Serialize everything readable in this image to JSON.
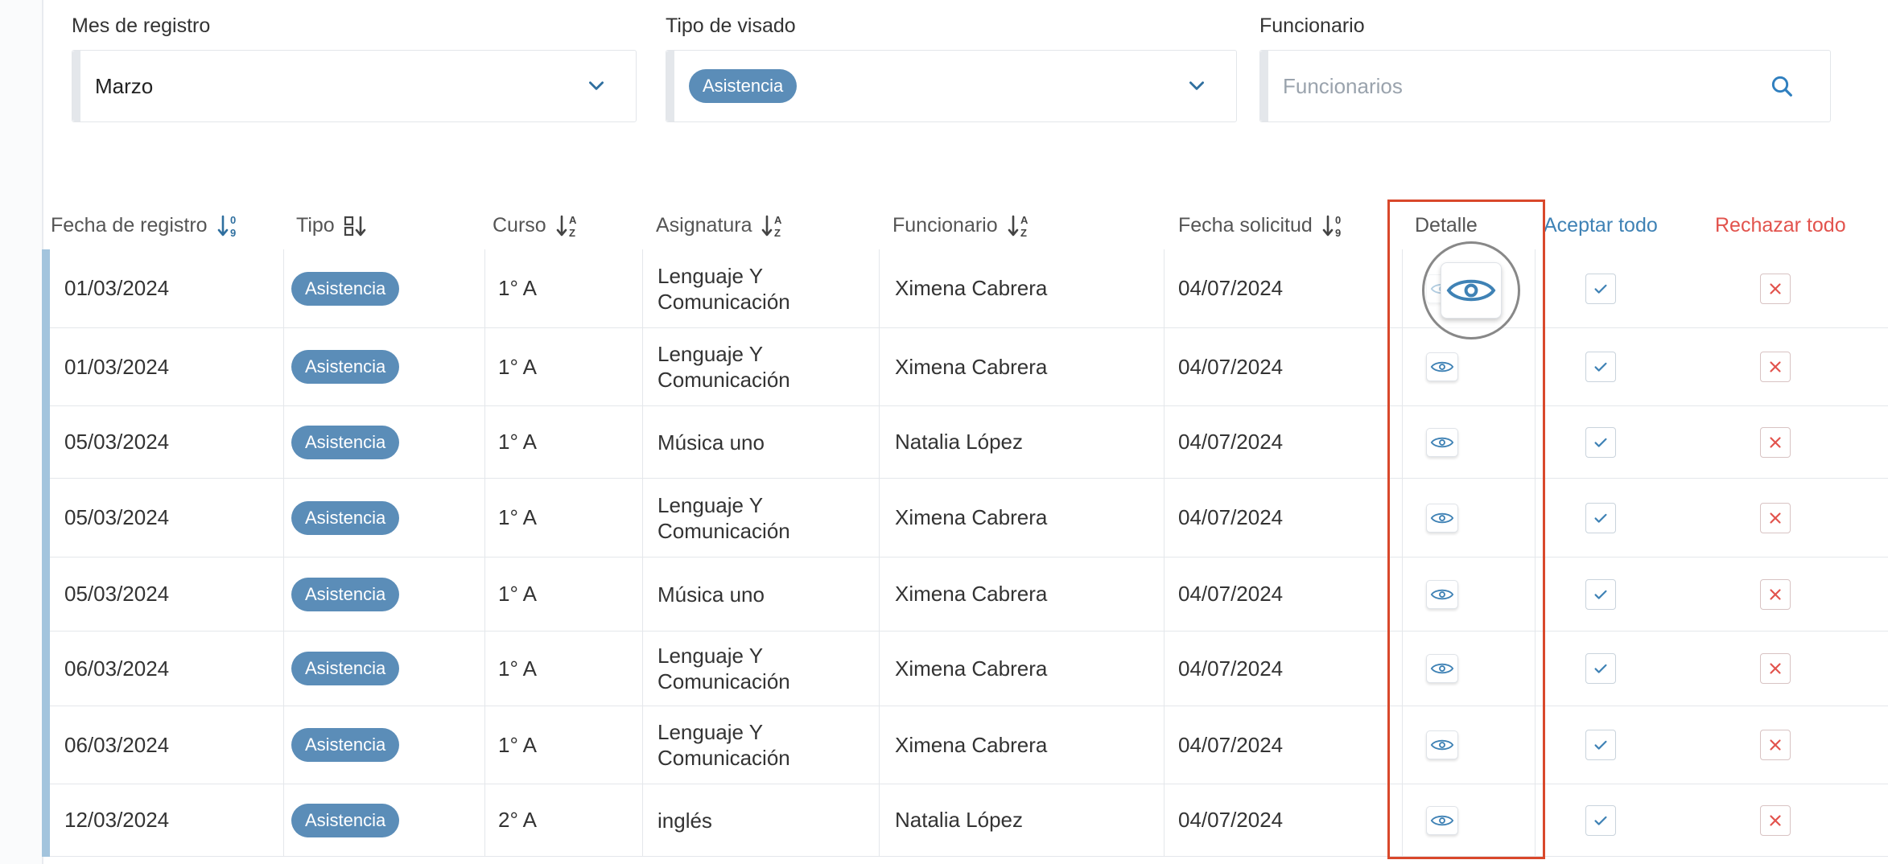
{
  "filters": {
    "month": {
      "label": "Mes de registro",
      "value": "Marzo"
    },
    "visa_type": {
      "label": "Tipo de visado",
      "selected_tag": "Asistencia"
    },
    "official": {
      "label": "Funcionario",
      "placeholder": "Funcionarios"
    }
  },
  "table": {
    "headers": {
      "fecha_registro": "Fecha de registro",
      "tipo": "Tipo",
      "curso": "Curso",
      "asignatura": "Asignatura",
      "funcionario": "Funcionario",
      "fecha_solicitud": "Fecha solicitud",
      "detalle": "Detalle",
      "aceptar_todo": "Aceptar todo",
      "rechazar_todo": "Rechazar todo"
    },
    "rows": [
      {
        "fecha": "01/03/2024",
        "tipo": "Asistencia",
        "curso": "1° A",
        "asignatura": [
          "Lenguaje Y",
          "Comunicación"
        ],
        "funcionario": "Ximena Cabrera",
        "solicitud": "04/07/2024"
      },
      {
        "fecha": "01/03/2024",
        "tipo": "Asistencia",
        "curso": "1° A",
        "asignatura": [
          "Lenguaje Y",
          "Comunicación"
        ],
        "funcionario": "Ximena Cabrera",
        "solicitud": "04/07/2024"
      },
      {
        "fecha": "05/03/2024",
        "tipo": "Asistencia",
        "curso": "1° A",
        "asignatura": [
          "Música uno"
        ],
        "funcionario": "Natalia López",
        "solicitud": "04/07/2024"
      },
      {
        "fecha": "05/03/2024",
        "tipo": "Asistencia",
        "curso": "1° A",
        "asignatura": [
          "Lenguaje Y",
          "Comunicación"
        ],
        "funcionario": "Ximena Cabrera",
        "solicitud": "04/07/2024"
      },
      {
        "fecha": "05/03/2024",
        "tipo": "Asistencia",
        "curso": "1° A",
        "asignatura": [
          "Música uno"
        ],
        "funcionario": "Ximena Cabrera",
        "solicitud": "04/07/2024"
      },
      {
        "fecha": "06/03/2024",
        "tipo": "Asistencia",
        "curso": "1° A",
        "asignatura": [
          "Lenguaje Y",
          "Comunicación"
        ],
        "funcionario": "Ximena Cabrera",
        "solicitud": "04/07/2024"
      },
      {
        "fecha": "06/03/2024",
        "tipo": "Asistencia",
        "curso": "1° A",
        "asignatura": [
          "Lenguaje Y",
          "Comunicación"
        ],
        "funcionario": "Ximena Cabrera",
        "solicitud": "04/07/2024"
      },
      {
        "fecha": "12/03/2024",
        "tipo": "Asistencia",
        "curso": "2° A",
        "asignatura": [
          "inglés"
        ],
        "funcionario": "Natalia López",
        "solicitud": "04/07/2024"
      }
    ]
  },
  "colors": {
    "pill": "#5b8db8",
    "accent_blue": "#3f82b5",
    "reject_red": "#e2534d",
    "highlight": "#d9482b"
  },
  "icons": {
    "sort_numeric": "sort-numeric-icon",
    "sort_alpha": "sort-alpha-icon",
    "sort_type": "sort-type-icon",
    "detail": "eye-icon",
    "accept": "check-icon",
    "reject": "x-icon",
    "dropdown": "chevron-down-icon",
    "search": "search-icon"
  }
}
